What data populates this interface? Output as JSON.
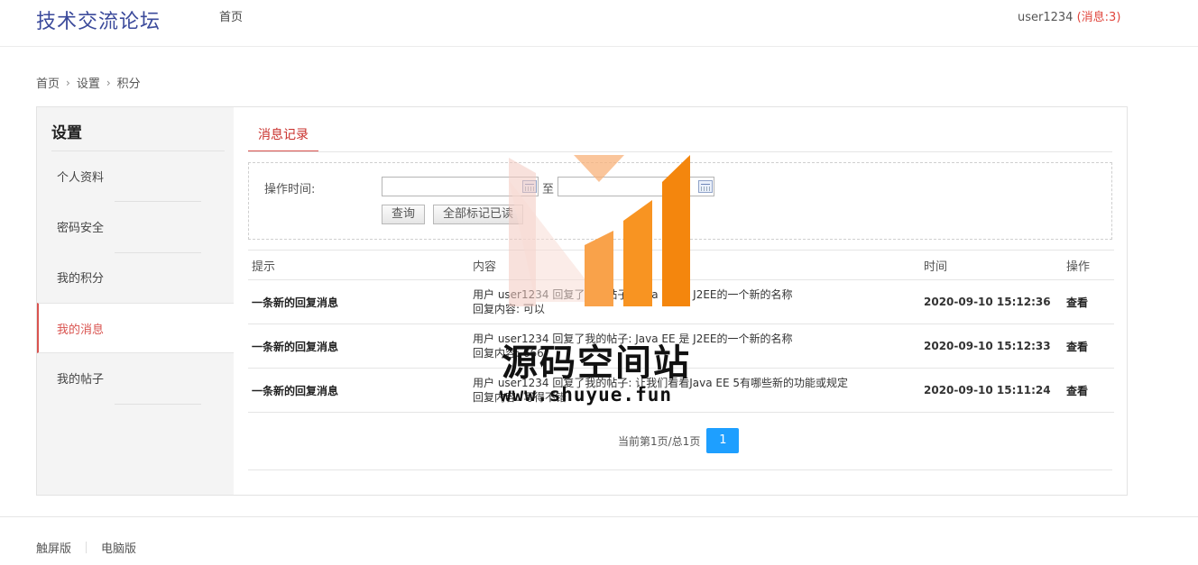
{
  "header": {
    "logo": "技术交流论坛",
    "nav_home": "首页",
    "username": "user1234",
    "messages_label": "(消息:3)"
  },
  "breadcrumb": {
    "items": [
      "首页",
      "设置",
      "积分"
    ]
  },
  "sidebar": {
    "title": "设置",
    "items": [
      {
        "label": "个人资料"
      },
      {
        "label": "密码安全"
      },
      {
        "label": "我的积分"
      },
      {
        "label": "我的消息"
      },
      {
        "label": "我的帖子"
      }
    ],
    "active_index": 3
  },
  "tab": {
    "label": "消息记录"
  },
  "filter": {
    "time_label": "操作时间:",
    "start_value": "",
    "end_value": "",
    "to_label": "至",
    "query_button": "查询",
    "mark_all_button": "全部标记已读"
  },
  "table": {
    "headers": {
      "tip": "提示",
      "content": "内容",
      "time": "时间",
      "op": "操作"
    },
    "rows": [
      {
        "tip": "一条新的回复消息",
        "content_line1": "用户 user1234 回复了我的帖子: Java EE 是 J2EE的一个新的名称",
        "content_line2": "回复内容: 可以",
        "time": "2020-09-10 15:12:36",
        "op": "查看"
      },
      {
        "tip": "一条新的回复消息",
        "content_line1": "用户 user1234 回复了我的帖子: Java EE 是 J2EE的一个新的名称",
        "content_line2": "回复内容: 666",
        "time": "2020-09-10 15:12:33",
        "op": "查看"
      },
      {
        "tip": "一条新的回复消息",
        "content_line1": "用户 user1234 回复了我的帖子: 让我们看看Java EE 5有哪些新的功能或规定",
        "content_line2": "回复内容: 写得不错",
        "time": "2020-09-10 15:11:24",
        "op": "查看"
      }
    ]
  },
  "pager": {
    "info": "当前第1页/总1页",
    "current_page": "1"
  },
  "footer": {
    "touch_version": "触屏版",
    "pc_version": "电脑版"
  },
  "watermark": {
    "text": "源码空间站",
    "url": "www.shuyue.fun"
  },
  "colors": {
    "accent_red": "#d9534f",
    "logo_blue": "#3b4a9b",
    "page_blue": "#1e9fff",
    "watermark_orange": "#f7941d"
  }
}
